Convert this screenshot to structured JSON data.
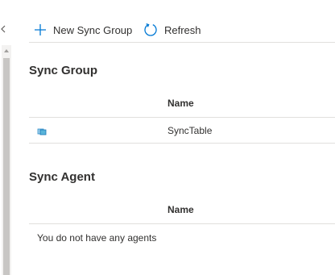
{
  "toolbar": {
    "new_sync_group_label": "New Sync Group",
    "refresh_label": "Refresh"
  },
  "sync_group": {
    "title": "Sync Group",
    "column_name": "Name",
    "rows": [
      {
        "icon": "sync-group-icon",
        "name": "SyncTable"
      }
    ]
  },
  "sync_agent": {
    "title": "Sync Agent",
    "column_name": "Name",
    "empty_message": "You do not have any agents"
  },
  "colors": {
    "accent": "#0078d4",
    "divider": "#e1dfdd",
    "text": "#323130"
  }
}
